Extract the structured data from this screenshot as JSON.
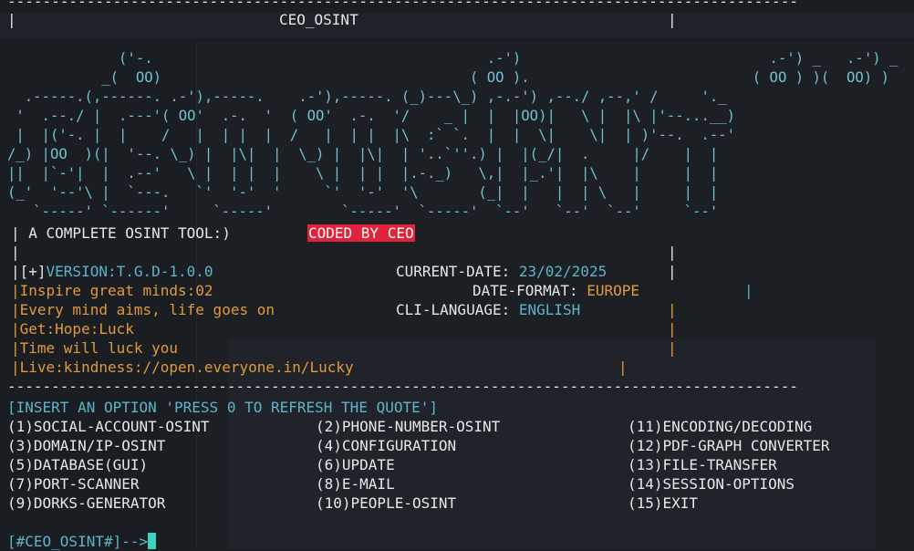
{
  "title": "CEO_OSINT",
  "rule_line": "------------------------------------------------------------------------------------------",
  "title_line": {
    "left": "|",
    "right": "|"
  },
  "ascii_art": [
    "             ('-.                                       .-')                             .-') _   .-') _",
    "           _(  OO)                                    ( OO ).                          ( OO ) )(  OO) )",
    "  .-----.(,------. .-'),-----.    .-'),-----. (_)---\\_) ,-.-') ,--./ ,--,' /     '._",
    " '  .--./ |  .---'( OO'  .-.  '  ( OO'  .-.  '/    _ |  |  |OO)|   \\ |  |\\ |'--...__)",
    " |  |('-. |  |    /   |  | |  |  /   |  | |  |\\  :` `.  |  |  \\|    \\|  | )'--.  .--'",
    "/_) |OO  )(|  '--. \\_) |  |\\|  |  \\_) |  |\\|  | '..`''.) |  |(_/|  .     |/    |  |",
    "||  |`-'|  |  .--'   \\ |  | |  |    \\ |  | |  |.-._)   \\,|  |_.'|  |\\    |     |  |",
    "(_'  '--'\\ |  `---.   `'  '-'  '     `'  '-'  '\\       (_|  |   |  | \\   |     |  |",
    "   `-----' `------'     `-----'        `-----'  `-----'  `--'   `--'  `--'     `--'"
  ],
  "tagline": "| A COMPLETE OSINT TOOL:)",
  "coded_by": "CODED BY CEO",
  "pipe": "|",
  "version_prefix": "|[+]",
  "version": "VERSION:T.G.D-1.0.0",
  "current_date_label": "CURRENT-DATE:",
  "current_date": "23/02/2025",
  "date_format_label": "DATE-FORMAT:",
  "date_format": "EUROPE",
  "cli_language_label": "CLI-LANGUAGE:",
  "cli_language": "ENGLISH",
  "quote_lines": [
    "|Inspire great minds:02",
    "|Every mind aims, life goes on",
    "|Get:Hope:Luck",
    "|Time will luck you",
    "|Live:kindness://open.everyone.in/Lucky"
  ],
  "insert_prompt": "[INSERT AN OPTION 'PRESS 0 TO REFRESH THE QUOTE']",
  "options": [
    [
      "(1)SOCIAL-ACCOUNT-OSINT",
      "(2)PHONE-NUMBER-OSINT",
      "(11)ENCODING/DECODING"
    ],
    [
      "(3)DOMAIN/IP-OSINT",
      "(4)CONFIGURATION",
      "(12)PDF-GRAPH CONVERTER"
    ],
    [
      "(5)DATABASE(GUI)",
      "(6)UPDATE",
      "(13)FILE-TRANSFER"
    ],
    [
      "(7)PORT-SCANNER",
      "(8)E-MAIL",
      "(14)SESSION-OPTIONS"
    ],
    [
      "(9)DORKS-GENERATOR",
      "(10)PEOPLE-OSINT",
      "(15)EXIT"
    ]
  ],
  "prompt": "[#CEO_OSINT#]-->",
  "colors": {
    "background": "#1a1d22",
    "cyan": "#5fb3c9",
    "orange": "#e09a3c",
    "badge_red": "#e0223a",
    "cursor": "#3fd0c0"
  }
}
